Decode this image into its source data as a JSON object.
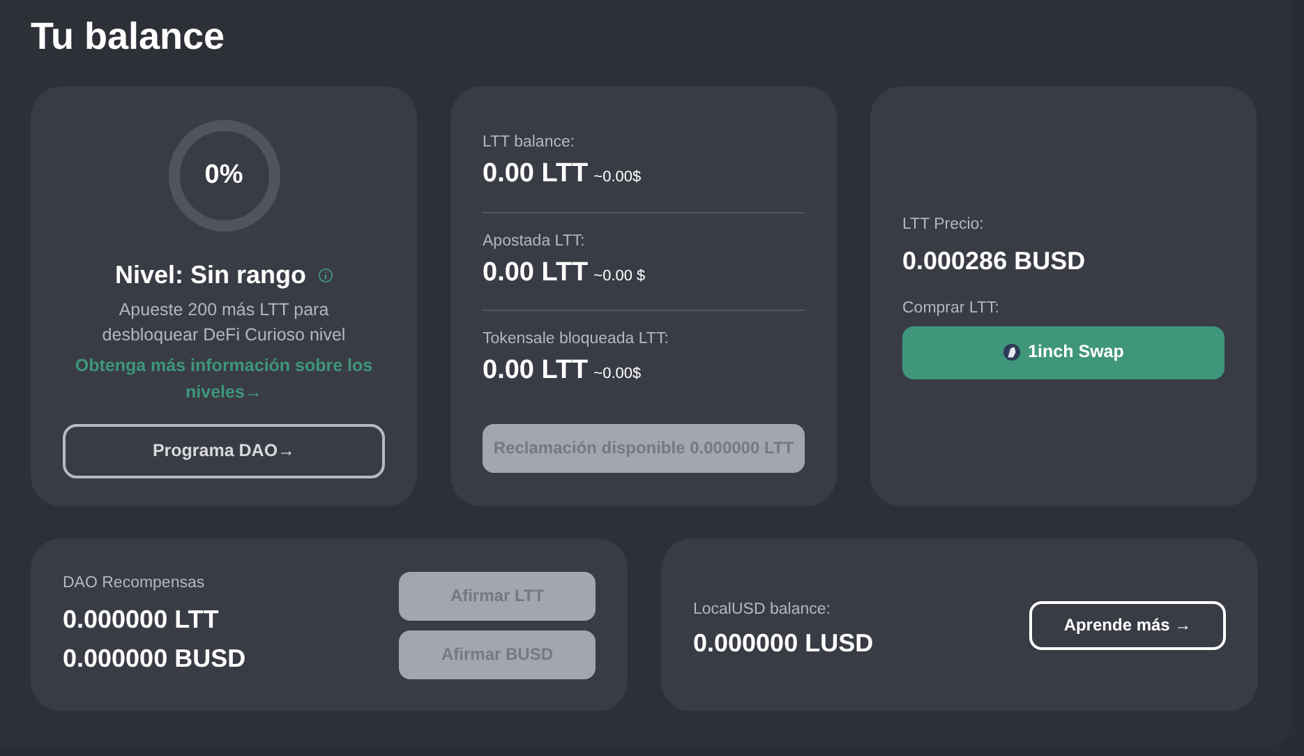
{
  "title": "Tu balance",
  "level_card": {
    "percent": "0%",
    "title": "Nivel: Sin rango",
    "description": "Apueste 200 más LTT para desbloquear DeFi Curioso nivel",
    "link": "Obtenga más información sobre los niveles→",
    "button": "Programa DAO→"
  },
  "balance_card": {
    "items": [
      {
        "label": "LTT balance:",
        "amount": "0.00 LTT",
        "usd": "~0.00$"
      },
      {
        "label": "Apostada LTT:",
        "amount": "0.00 LTT",
        "usd": "~0.00 $"
      },
      {
        "label": "Tokensale bloqueada LTT:",
        "amount": "0.00 LTT",
        "usd": "~0.00$"
      }
    ],
    "claim_button": {
      "label": "Reclamación disponible 0.000000 LTT",
      "disabled": true
    }
  },
  "price_card": {
    "label": "LTT Precio:",
    "value": "0.000286 BUSD",
    "buy_label": "Comprar LTT:",
    "swap_button": "1inch Swap"
  },
  "rewards_card": {
    "label": "DAO Recompensas",
    "amounts": [
      "0.000000 LTT",
      "0.000000 BUSD"
    ],
    "buttons": [
      {
        "label": "Afirmar LTT",
        "disabled": true
      },
      {
        "label": "Afirmar BUSD",
        "disabled": true
      }
    ]
  },
  "lusd_card": {
    "label": "LocalUSD balance:",
    "value": "0.000000 LUSD",
    "button": "Aprende más →"
  }
}
